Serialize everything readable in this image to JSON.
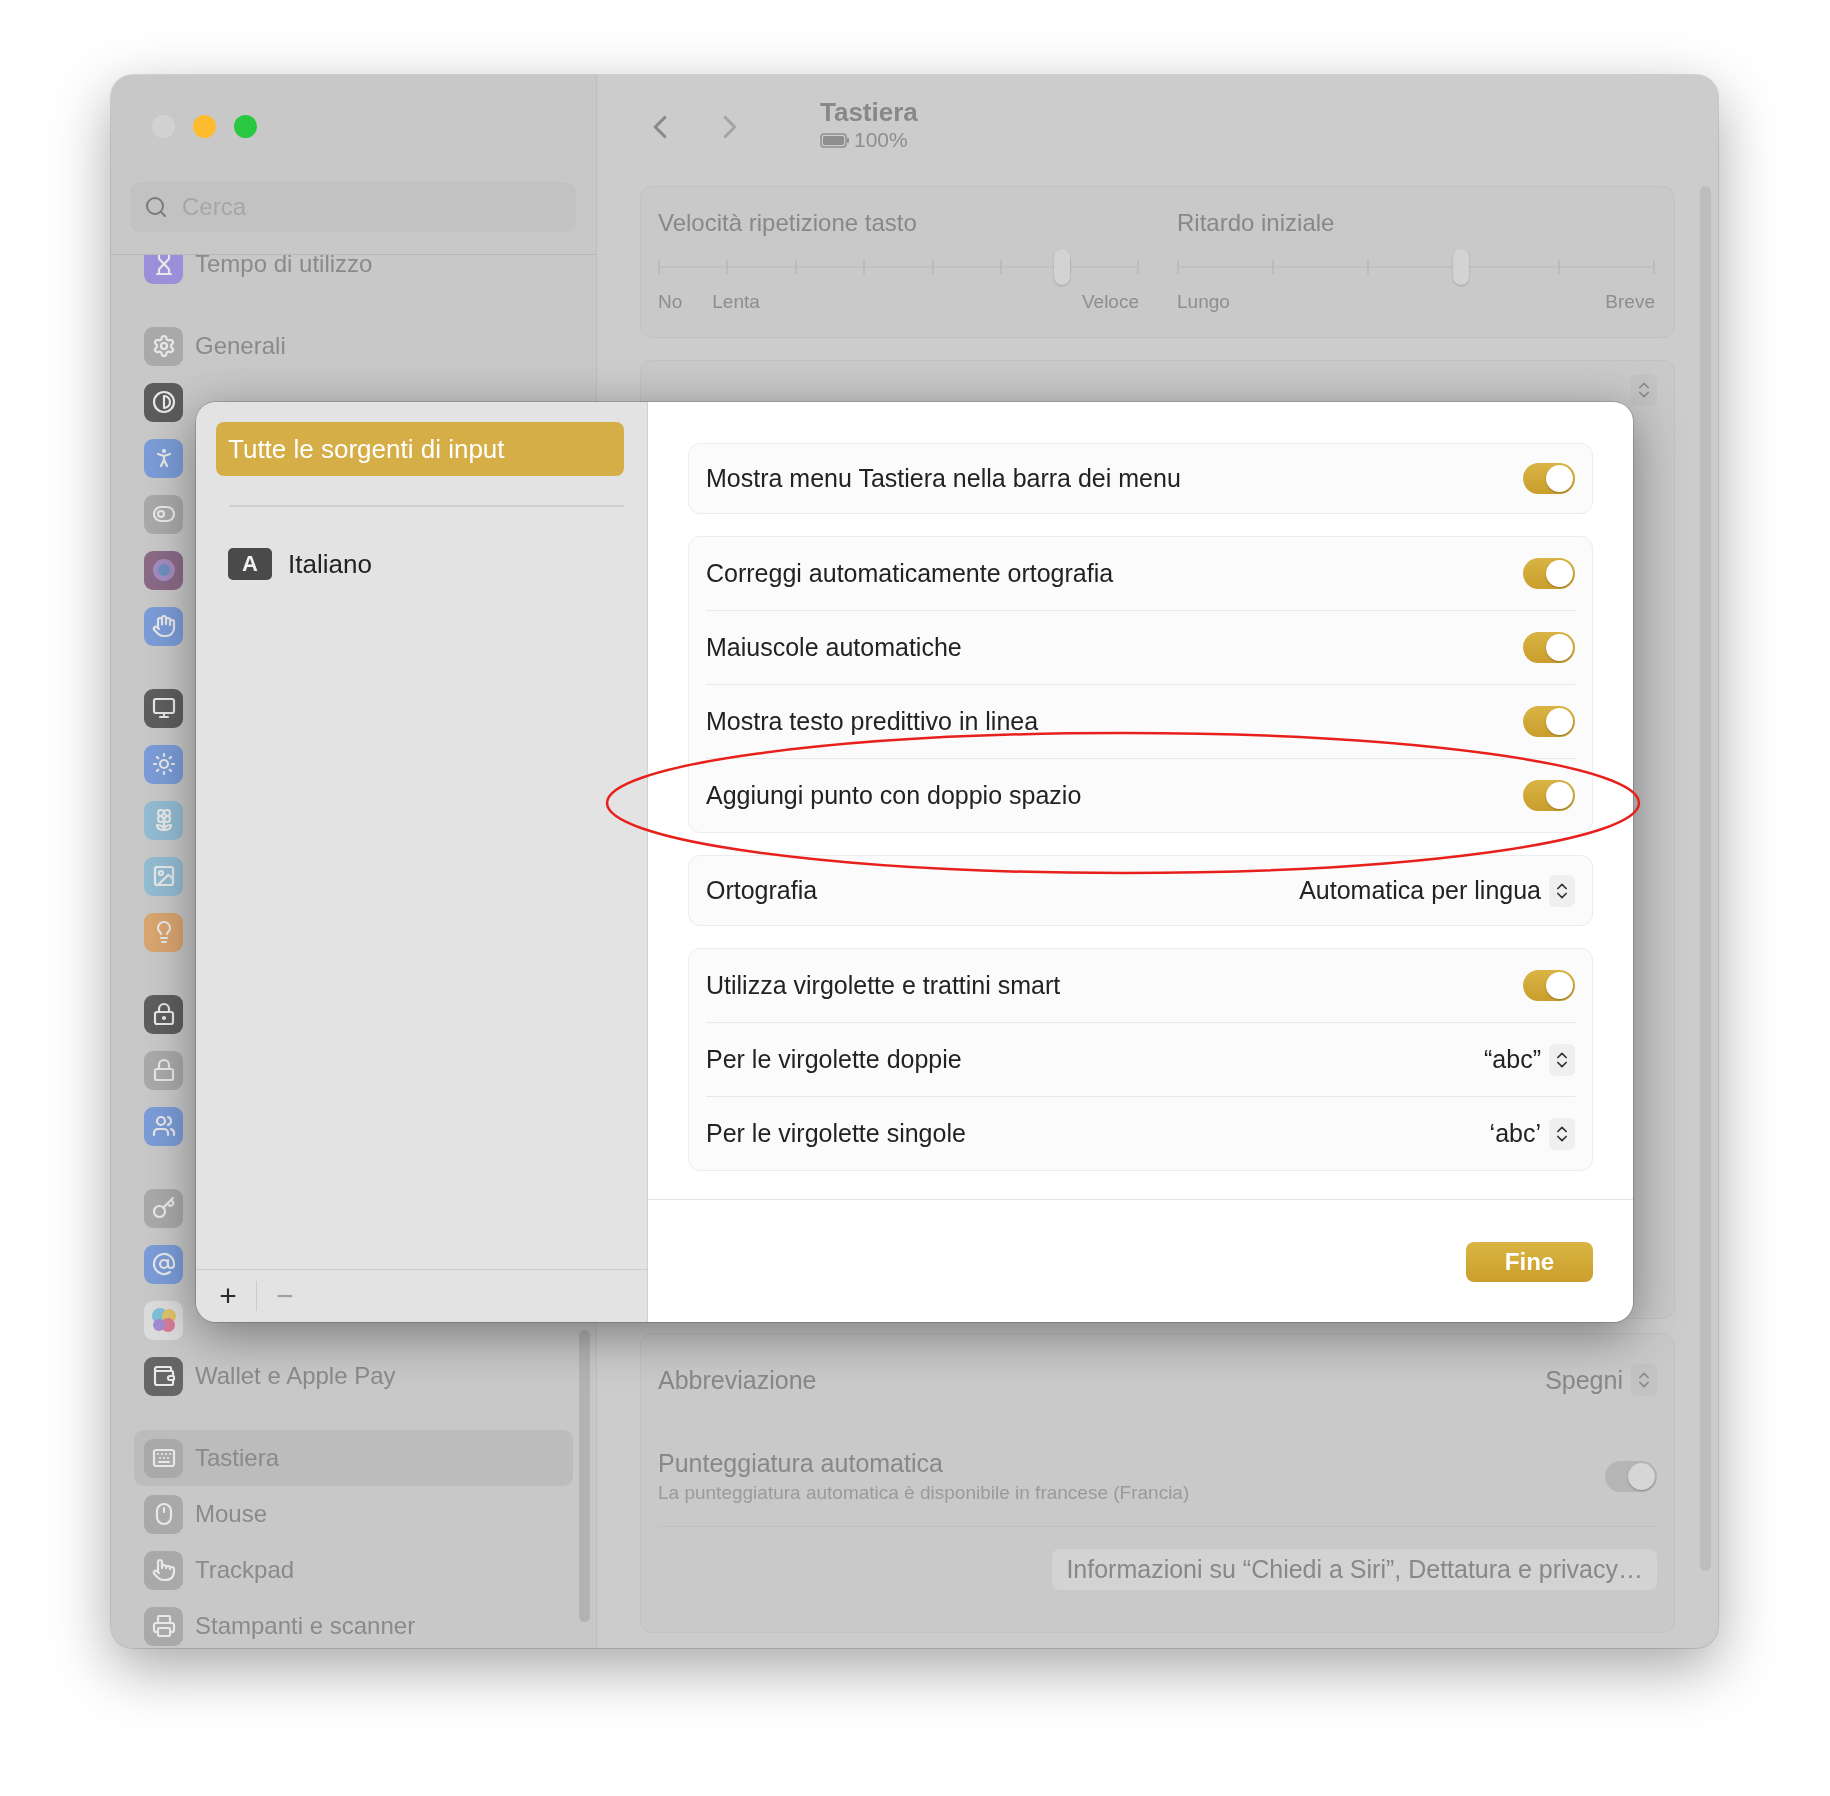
{
  "window": {
    "traffic_lights": [
      {
        "color": "#d2d2d2"
      },
      {
        "color": "#fdbc2e"
      },
      {
        "color": "#29c840"
      }
    ]
  },
  "sidebar": {
    "search": {
      "placeholder": "Cerca"
    },
    "groups": [
      [
        {
          "label": "Tempo di utilizzo",
          "selected": false
        }
      ],
      [
        {
          "label": "Generali",
          "selected": false
        },
        {
          "selected": false
        },
        {
          "selected": false
        },
        {
          "selected": false
        },
        {
          "selected": false
        },
        {
          "selected": false
        }
      ],
      [
        {
          "selected": false
        },
        {
          "selected": false
        },
        {
          "selected": false
        },
        {
          "selected": false
        },
        {
          "selected": false
        }
      ],
      [
        {
          "selected": false
        },
        {
          "selected": false
        },
        {
          "selected": false
        }
      ],
      [
        {
          "selected": false
        },
        {
          "selected": false
        },
        {
          "selected": false
        },
        {
          "label": "Wallet e Apple Pay",
          "selected": false
        }
      ],
      [
        {
          "label": "Tastiera",
          "selected": true
        },
        {
          "label": "Mouse",
          "selected": false
        },
        {
          "label": "Trackpad",
          "selected": false
        },
        {
          "label": "Stampanti e scanner",
          "selected": false
        }
      ]
    ]
  },
  "toolbar": {
    "title": "Tastiera",
    "battery": "100%"
  },
  "key_repeat": {
    "sliders": [
      {
        "title": "Velocità ripetizione tasto",
        "level": 0.84,
        "labels": [
          {
            "text": "No",
            "kind": "left"
          },
          {
            "text": "Lenta",
            "kind": "left"
          },
          {
            "text": "Veloce",
            "kind": "right"
          }
        ]
      },
      {
        "title": "Ritardo iniziale",
        "level": 0.595,
        "labels": [
          {
            "text": "Lungo",
            "kind": "left"
          },
          {
            "text": "Breve",
            "kind": "right"
          }
        ]
      }
    ]
  },
  "lower": {
    "rows": [
      {
        "kind": "popup",
        "label": "Abbreviazione",
        "value": "Spegni"
      },
      {
        "kind": "toggle",
        "label": "Punteggiatura automatica",
        "note": "La punteggiatura automatica è disponibile in francese (Francia)",
        "on": true,
        "disabled": true
      }
    ],
    "button": "Informazioni su “Chiedi a Siri”, Dettatura e privacy…"
  },
  "sheet": {
    "sources": [
      {
        "label": "Tutte le sorgenti di input",
        "selected": true
      },
      {
        "label": "Italiano",
        "badge": "A",
        "selected": false
      }
    ],
    "list_buttons": [
      {
        "label": "+",
        "disabled": false
      },
      {
        "label": "−",
        "disabled": true
      }
    ],
    "groups": [
      [
        {
          "kind": "toggle",
          "label": "Mostra menu Tastiera nella barra dei menu",
          "on": true
        }
      ],
      [
        {
          "kind": "toggle",
          "label": "Correggi automaticamente ortografia",
          "on": true
        },
        {
          "kind": "toggle",
          "label": "Maiuscole automatiche",
          "on": true
        },
        {
          "kind": "toggle",
          "label": "Mostra testo predittivo in linea",
          "on": true
        },
        {
          "kind": "toggle",
          "label": "Aggiungi punto con doppio spazio",
          "on": true
        }
      ],
      [
        {
          "kind": "popup",
          "label": "Ortografia",
          "value": "Automatica per lingua"
        }
      ],
      [
        {
          "kind": "toggle",
          "label": "Utilizza virgolette e trattini smart",
          "on": true
        },
        {
          "kind": "popup",
          "label": "Per le virgolette doppie",
          "value": "“abc”"
        },
        {
          "kind": "popup",
          "label": "Per le virgolette singole",
          "value": "‘abc’"
        }
      ]
    ],
    "done_button": "Fine"
  }
}
